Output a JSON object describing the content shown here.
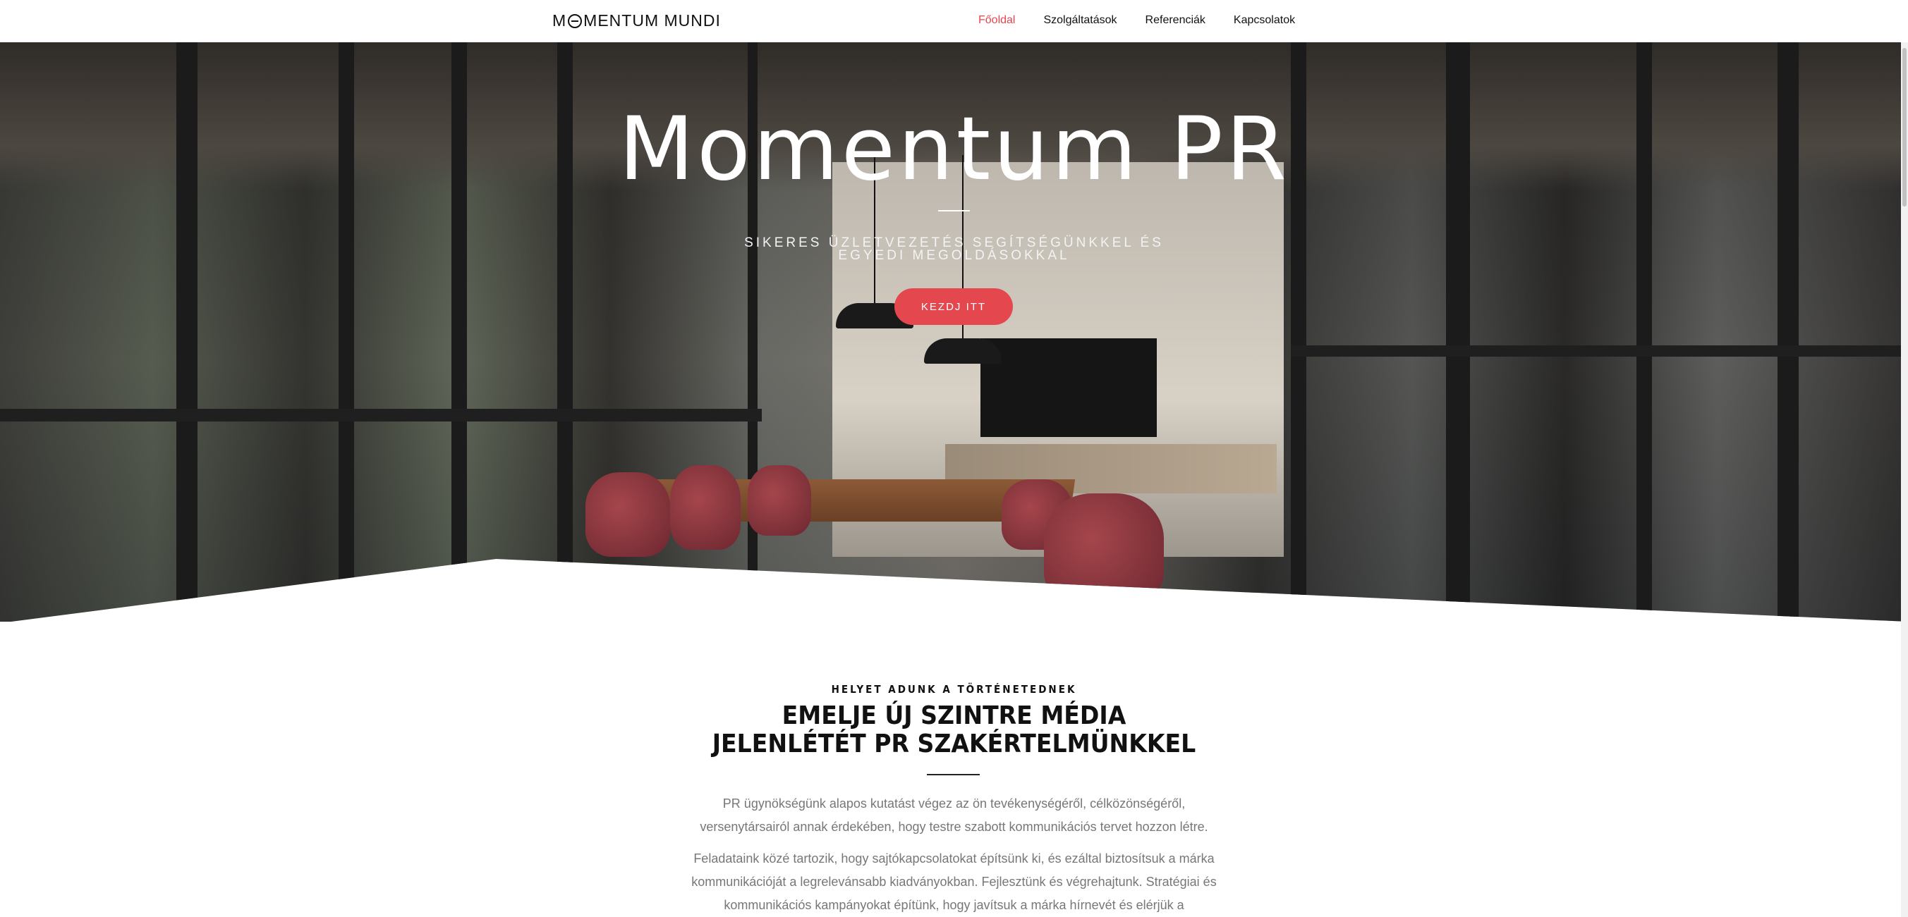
{
  "header": {
    "logo_text_before": "M",
    "logo_text_after": "MENTUM MUNDI",
    "nav": [
      {
        "label": "Főoldal",
        "active": true
      },
      {
        "label": "Szolgáltatások",
        "active": false
      },
      {
        "label": "Referenciák",
        "active": false
      },
      {
        "label": "Kapcsolatok",
        "active": false
      }
    ]
  },
  "hero": {
    "title": "Momentum PR",
    "subtitle": "SIKERES ÜZLETVEZETÉS SEGÍTSÉGÜNKKEL ÉS EGYEDI MEGOLDÁSOKKAL",
    "cta_label": "KEZDJ ITT"
  },
  "section": {
    "eyebrow": "HELYET ADUNK A TÖRTÉNETEDNEK",
    "headline_line1": "EMELJE ÚJ SZINTRE MÉDIA",
    "headline_line2": "JELENLÉTÉT PR SZAKÉRTELMÜNKKEL",
    "paragraph1": "PR ügynökségünk alapos kutatást végez az ön tevékenységéről, célközönségéről, versenytársairól annak érdekében, hogy testre szabott kommunikációs tervet hozzon létre.",
    "paragraph2": "Feladataink közé tartozik, hogy sajtókapcsolatokat építsünk ki, és ezáltal biztosítsuk a márka kommunikációját a legrelevánsabb kiadványokban. Fejlesztünk és végrehajtunk. Stratégiai és kommunikációs kampányokat építünk, hogy javítsuk a márka hírnevét és elérjük a"
  },
  "colors": {
    "accent": "#e5474e",
    "text": "#111111",
    "muted": "#777777"
  }
}
